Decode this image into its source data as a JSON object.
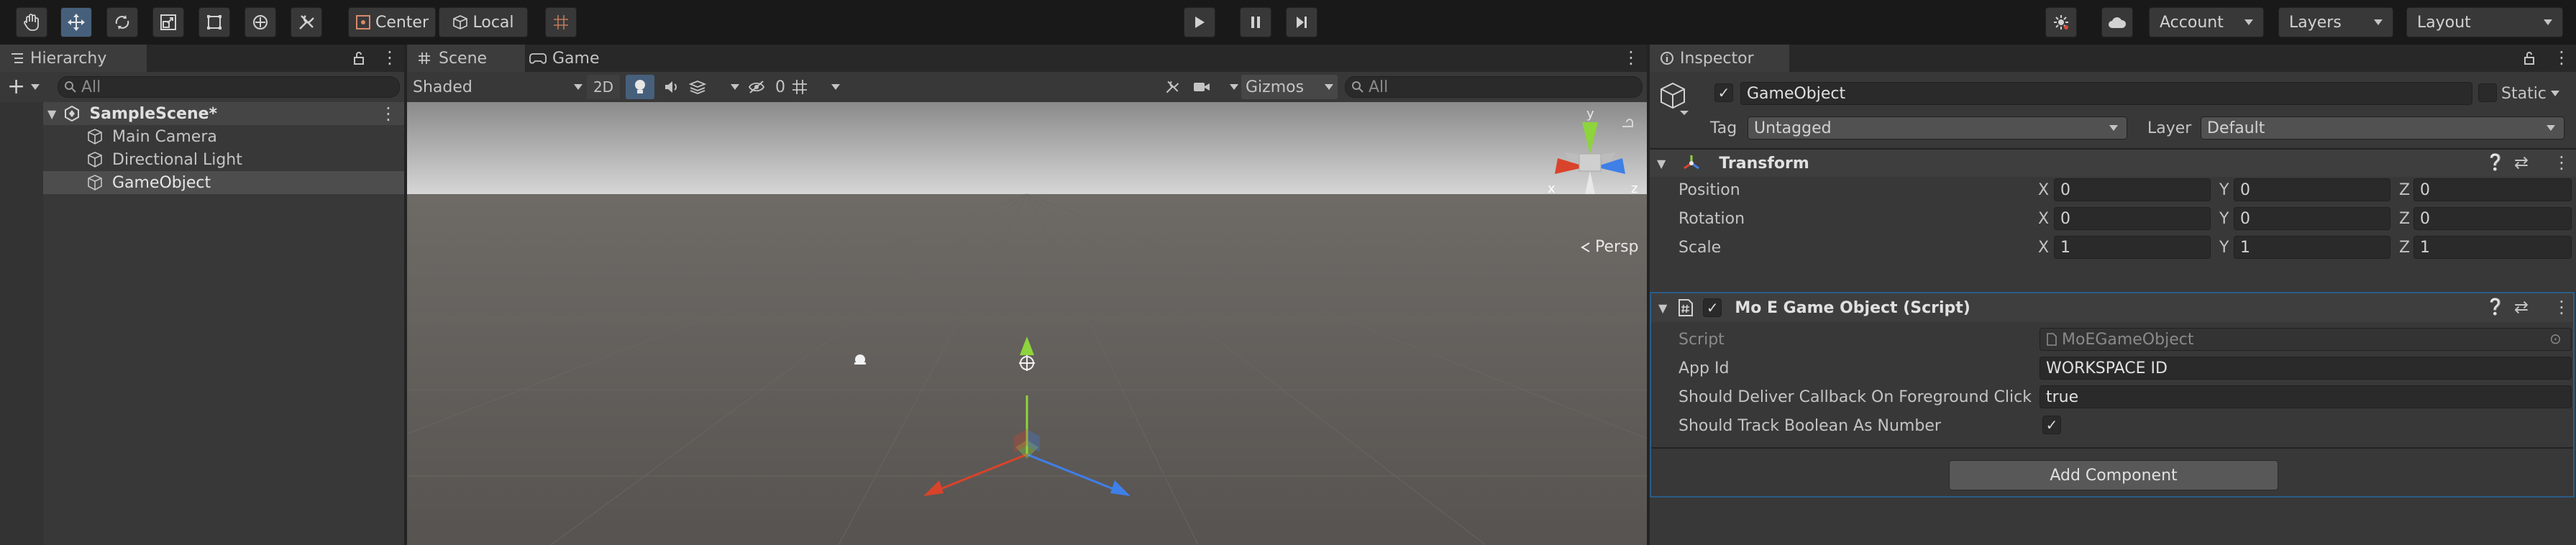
{
  "toolbar": {
    "pivot_label": "Center",
    "space_label": "Local",
    "account_label": "Account",
    "layers_label": "Layers",
    "layout_label": "Layout"
  },
  "hierarchy": {
    "tab_label": "Hierarchy",
    "search_placeholder": "All",
    "scene_name": "SampleScene*",
    "items": [
      "Main Camera",
      "Directional Light",
      "GameObject"
    ],
    "selected": "GameObject"
  },
  "scene_view": {
    "tabs": [
      "Scene",
      "Game"
    ],
    "shading_mode": "Shaded",
    "mode_2d_label": "2D",
    "hidden_count": "0",
    "gizmos_label": "Gizmos",
    "search_placeholder": "All",
    "persp_label": "Persp",
    "axis_labels": {
      "x": "x",
      "y": "y",
      "z": "z"
    },
    "colors": {
      "sky_top": "#8a8a8a",
      "sky_horizon": "#d6d6d6",
      "ground": "#5e5e5e",
      "x_axis": "#d9432b",
      "y_axis": "#8ed43c",
      "z_axis": "#3f7fe8"
    }
  },
  "inspector": {
    "tab_label": "Inspector",
    "object_name": "GameObject",
    "static_label": "Static",
    "tag_label": "Tag",
    "tag_value": "Untagged",
    "layer_label": "Layer",
    "layer_value": "Default",
    "transform": {
      "title": "Transform",
      "rows": [
        {
          "label": "Position",
          "x": "0",
          "y": "0",
          "z": "0"
        },
        {
          "label": "Rotation",
          "x": "0",
          "y": "0",
          "z": "0"
        },
        {
          "label": "Scale",
          "x": "1",
          "y": "1",
          "z": "1"
        }
      ],
      "axes": {
        "x": "X",
        "y": "Y",
        "z": "Z"
      }
    },
    "script_component": {
      "title": "Mo E Game Object (Script)",
      "script_label": "Script",
      "script_value": "MoEGameObject",
      "app_id_label": "App Id",
      "app_id_value": "WORKSPACE ID",
      "callback_label": "Should Deliver Callback On Foreground Click",
      "callback_value": "true",
      "track_label": "Should Track Boolean As Number",
      "track_checked": true
    },
    "add_component_label": "Add Component",
    "accent": "#2c5d87"
  }
}
